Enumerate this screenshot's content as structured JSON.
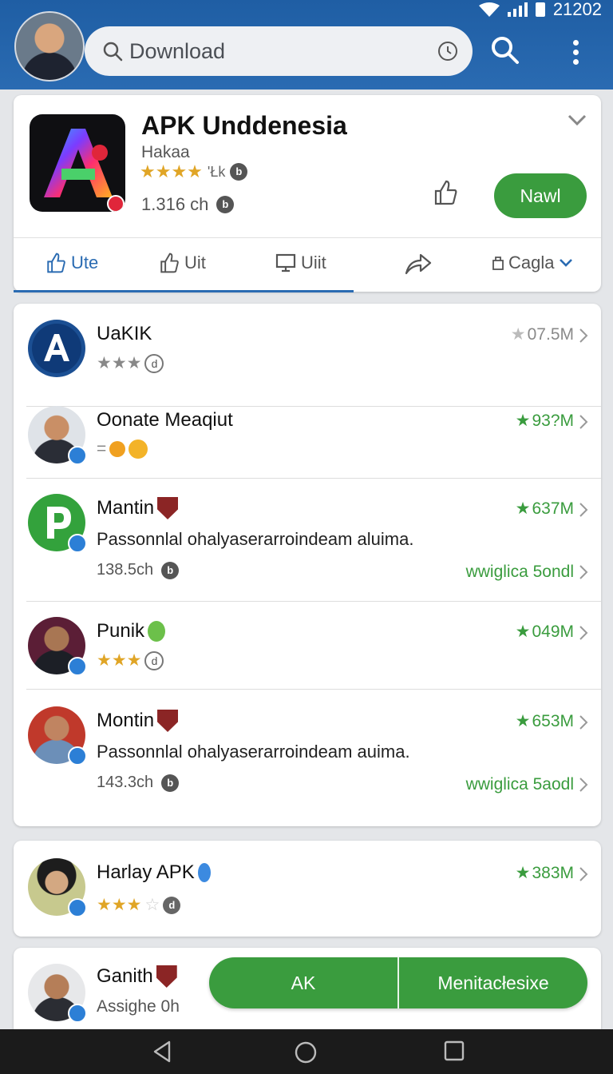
{
  "status": {
    "time": "21202"
  },
  "search": {
    "query": "Download",
    "icon": "search-icon",
    "history_icon": "clock-icon"
  },
  "hero": {
    "title": "APK Unddenesia",
    "subtitle": "Hakaa",
    "rating_extra": "'Łk",
    "size": "1.316 ch",
    "install_label": "Nawl"
  },
  "tabs": [
    {
      "label": "Ute",
      "icon": "thumbs-up-icon"
    },
    {
      "label": "Uit",
      "icon": "thumbs-up-outline-icon"
    },
    {
      "label": "Uiit",
      "icon": "monitor-icon"
    },
    {
      "label": "",
      "icon": "share-icon"
    },
    {
      "label": "Cagla",
      "icon": "filter-icon"
    }
  ],
  "apps": [
    {
      "name": "UaKIK",
      "rating": "07.5M",
      "stars": 3
    },
    {
      "name": "Oonate Meaqiut",
      "rating": "93?M",
      "meta": "="
    },
    {
      "name": "Mantin",
      "rating": "637M",
      "desc": "Passonnlal ohalyaserarroindeam aluima.",
      "size": "138.5ch",
      "link": "wwiglica 5ondl"
    },
    {
      "name": "Punik",
      "rating": "049M",
      "stars": 3
    },
    {
      "name": "Montin",
      "rating": "653M",
      "desc": "Passonnlal ohalyaserarroindeam auima.",
      "size": "143.3ch",
      "link": "wwiglica 5aodl"
    },
    {
      "name": "Harlay APK",
      "rating": "383M",
      "stars": 3
    },
    {
      "name": "Ganith",
      "sub": "Assighe 0h"
    }
  ],
  "bottom_buttons": {
    "left": "AK",
    "right": "Menitacłesixe"
  },
  "colors": {
    "accent": "#2a6bb2",
    "green": "#3a9c3e",
    "star": "#e0a526"
  }
}
